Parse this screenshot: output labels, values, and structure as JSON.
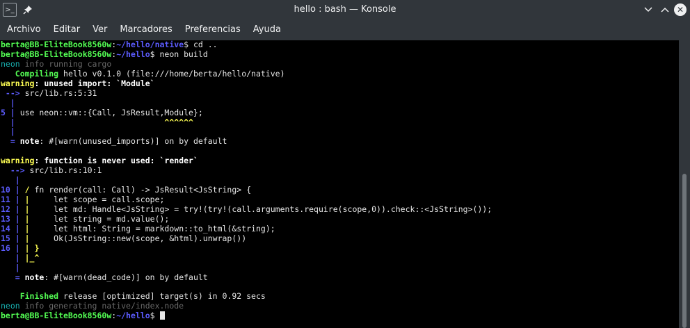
{
  "window": {
    "title": "hello : bash — Konsole"
  },
  "menu": [
    "Archivo",
    "Editar",
    "Ver",
    "Marcadores",
    "Preferencias",
    "Ayuda"
  ],
  "icons": {
    "app": "terminal-icon",
    "pin": "pin-icon",
    "minimize": "chevron-down-icon",
    "maximize": "chevron-up-icon",
    "close": "close-icon"
  },
  "colors": {
    "background": "#000000",
    "prompt_user": "#54ff54",
    "prompt_path": "#5c5cff",
    "warning": "#ffff54",
    "neon": "#18b2b2",
    "dim": "#686868"
  },
  "terminal": {
    "user_host": "berta@BB-EliteBook8560w",
    "lines": [
      [
        {
          "t": "berta@BB-EliteBook8560w",
          "c": "g"
        },
        {
          "t": ":"
        },
        {
          "t": "~/hello/native",
          "c": "b"
        },
        {
          "t": "$ cd .."
        }
      ],
      [
        {
          "t": "berta@BB-EliteBook8560w",
          "c": "g"
        },
        {
          "t": ":"
        },
        {
          "t": "~/hello",
          "c": "b"
        },
        {
          "t": "$ neon build"
        }
      ],
      [
        {
          "t": "neon",
          "c": "cy"
        },
        {
          "t": " info running cargo",
          "c": "gr"
        }
      ],
      [
        {
          "t": "   Compiling",
          "c": "g"
        },
        {
          "t": " hello v0.1.0 (file:///home/berta/hello/native)"
        }
      ],
      [
        {
          "t": "warning",
          "c": "y"
        },
        {
          "t": ": unused import: `Module`",
          "c": "w"
        }
      ],
      [
        {
          "t": " --> ",
          "c": "b"
        },
        {
          "t": "src/lib.rs:5:31"
        }
      ],
      [
        {
          "t": "  |",
          "c": "b"
        }
      ],
      [
        {
          "t": "5 | ",
          "c": "b"
        },
        {
          "t": "use neon::vm::{Call, JsResult,Module};"
        }
      ],
      [
        {
          "t": "  |                               ",
          "c": "b"
        },
        {
          "t": "^^^^^^",
          "c": "y"
        }
      ],
      [
        {
          "t": "  |",
          "c": "b"
        }
      ],
      [
        {
          "t": "  = ",
          "c": "b"
        },
        {
          "t": "note",
          "c": "w"
        },
        {
          "t": ": #[warn(unused_imports)] on by default"
        }
      ],
      [
        {
          "t": ""
        }
      ],
      [
        {
          "t": "warning",
          "c": "y"
        },
        {
          "t": ": function is never used: `render`",
          "c": "w"
        }
      ],
      [
        {
          "t": "  --> ",
          "c": "b"
        },
        {
          "t": "src/lib.rs:10:1"
        }
      ],
      [
        {
          "t": "   |",
          "c": "b"
        }
      ],
      [
        {
          "t": "10 | ",
          "c": "b"
        },
        {
          "t": "/",
          "c": "y"
        },
        {
          "t": " fn render(call: Call) -> JsResult<JsString> {"
        }
      ],
      [
        {
          "t": "11 | ",
          "c": "b"
        },
        {
          "t": "|",
          "c": "y"
        },
        {
          "t": "     let scope = call.scope;"
        }
      ],
      [
        {
          "t": "12 | ",
          "c": "b"
        },
        {
          "t": "|",
          "c": "y"
        },
        {
          "t": "     let md: Handle<JsString> = try!(try!(call.arguments.require(scope,0)).check::<JsString>());"
        }
      ],
      [
        {
          "t": "13 | ",
          "c": "b"
        },
        {
          "t": "|",
          "c": "y"
        },
        {
          "t": "     let string = md.value();"
        }
      ],
      [
        {
          "t": "14 | ",
          "c": "b"
        },
        {
          "t": "|",
          "c": "y"
        },
        {
          "t": "     let html: String = markdown::to_html(&string);"
        }
      ],
      [
        {
          "t": "15 | ",
          "c": "b"
        },
        {
          "t": "|",
          "c": "y"
        },
        {
          "t": "     Ok(JsString::new(scope, &html).unwrap())"
        }
      ],
      [
        {
          "t": "16 | ",
          "c": "b"
        },
        {
          "t": "| }",
          "c": "y"
        }
      ],
      [
        {
          "t": "   | ",
          "c": "b"
        },
        {
          "t": "|_^",
          "c": "y"
        }
      ],
      [
        {
          "t": "   |",
          "c": "b"
        }
      ],
      [
        {
          "t": "   = ",
          "c": "b"
        },
        {
          "t": "note",
          "c": "w"
        },
        {
          "t": ": #[warn(dead_code)] on by default"
        }
      ],
      [
        {
          "t": ""
        }
      ],
      [
        {
          "t": "    Finished",
          "c": "g"
        },
        {
          "t": " release [optimized] target(s) in 0.92 secs"
        }
      ],
      [
        {
          "t": "neon",
          "c": "cy"
        },
        {
          "t": " info generating native/index.node",
          "c": "gr"
        }
      ],
      [
        {
          "t": "berta@BB-EliteBook8560w",
          "c": "g"
        },
        {
          "t": ":"
        },
        {
          "t": "~/hello",
          "c": "b"
        },
        {
          "t": "$ "
        },
        {
          "t": "",
          "c": "cursor"
        }
      ]
    ]
  }
}
